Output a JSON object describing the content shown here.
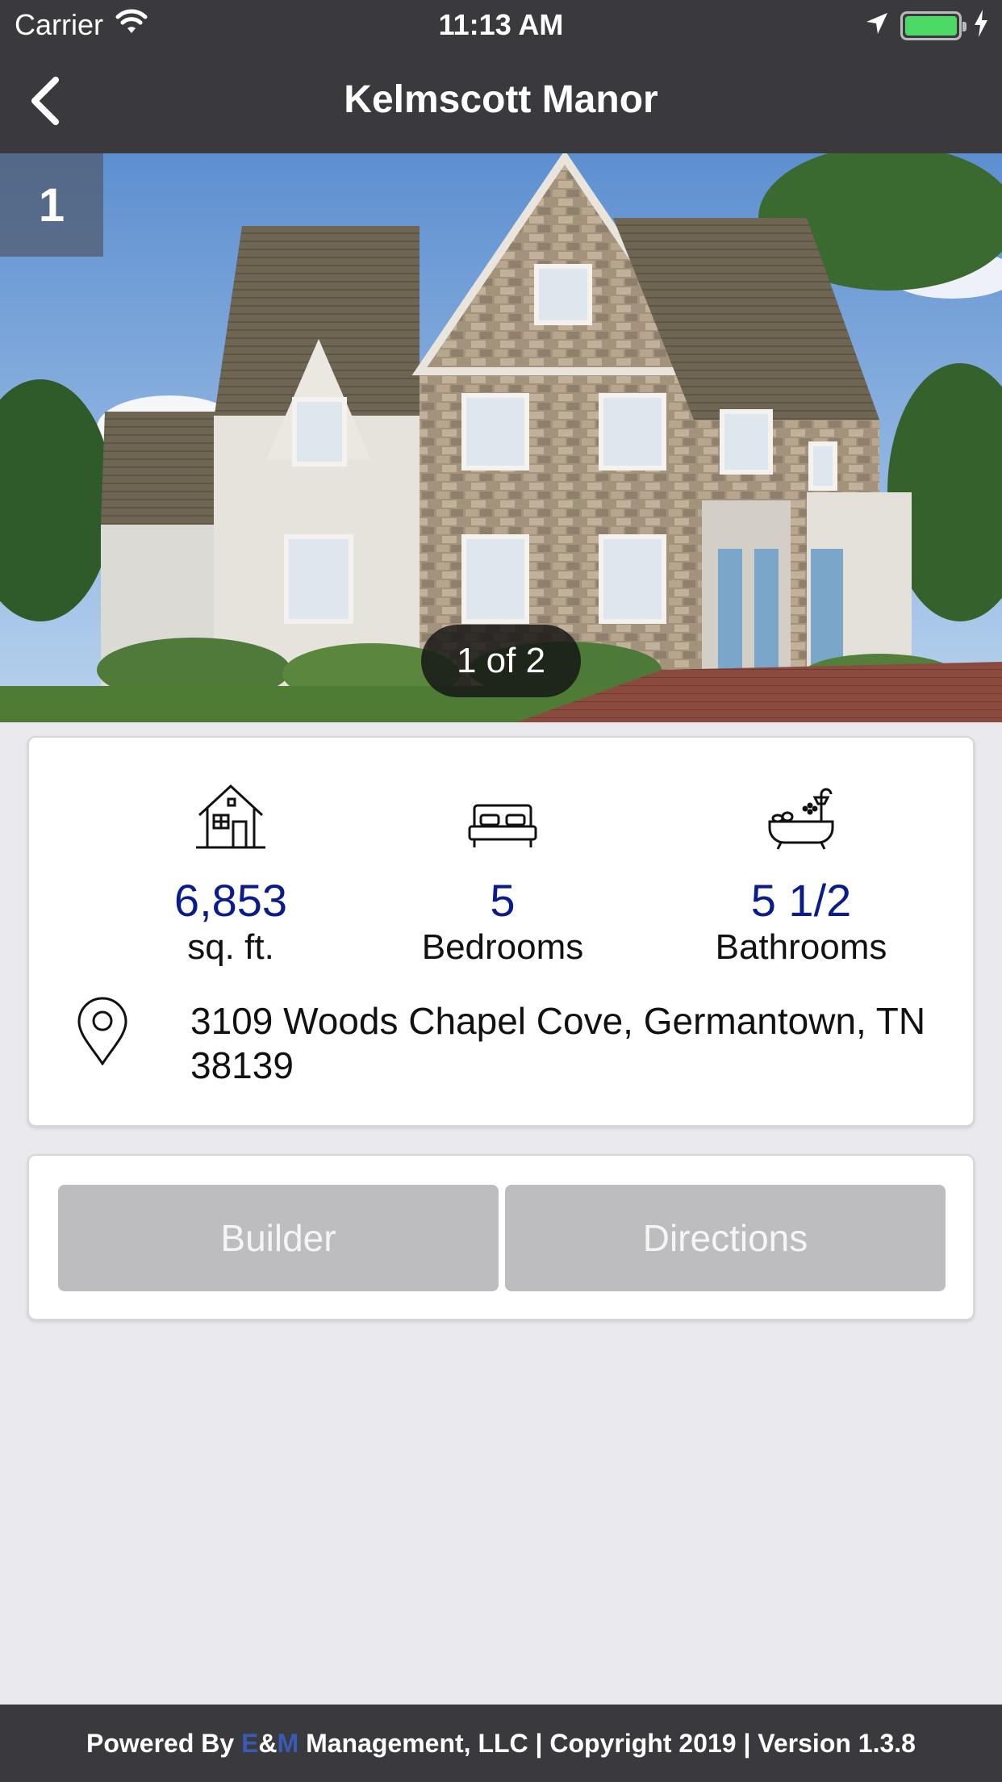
{
  "status_bar": {
    "carrier": "Carrier",
    "time": "11:13 AM",
    "battery_level": 1.0,
    "battery_color": "#4cd964"
  },
  "nav": {
    "title": "Kelmscott Manor",
    "back_icon": "chevron-left-icon"
  },
  "gallery": {
    "index_badge": "1",
    "pager_text": "1 of 2"
  },
  "stats": [
    {
      "icon": "house-icon",
      "value": "6,853",
      "label": "sq. ft."
    },
    {
      "icon": "bed-icon",
      "value": "5",
      "label": "Bedrooms"
    },
    {
      "icon": "bathtub-icon",
      "value": "5 1/2",
      "label": "Bathrooms"
    }
  ],
  "address": {
    "icon": "map-pin-icon",
    "text": "3109 Woods Chapel Cove, Germantown, TN 38139"
  },
  "actions": {
    "builder_label": "Builder",
    "directions_label": "Directions"
  },
  "footer": {
    "prefix": "Powered By ",
    "brand_e": "E",
    "brand_amp": "&",
    "brand_m": "M",
    "suffix": " Management, LLC | Copyright 2019 | Version 1.3.8"
  },
  "colors": {
    "header_bg": "#3a393e",
    "stat_value": "#0a1b8a",
    "button_bg": "#bdbdbf",
    "page_bg": "#e9e9ee"
  }
}
